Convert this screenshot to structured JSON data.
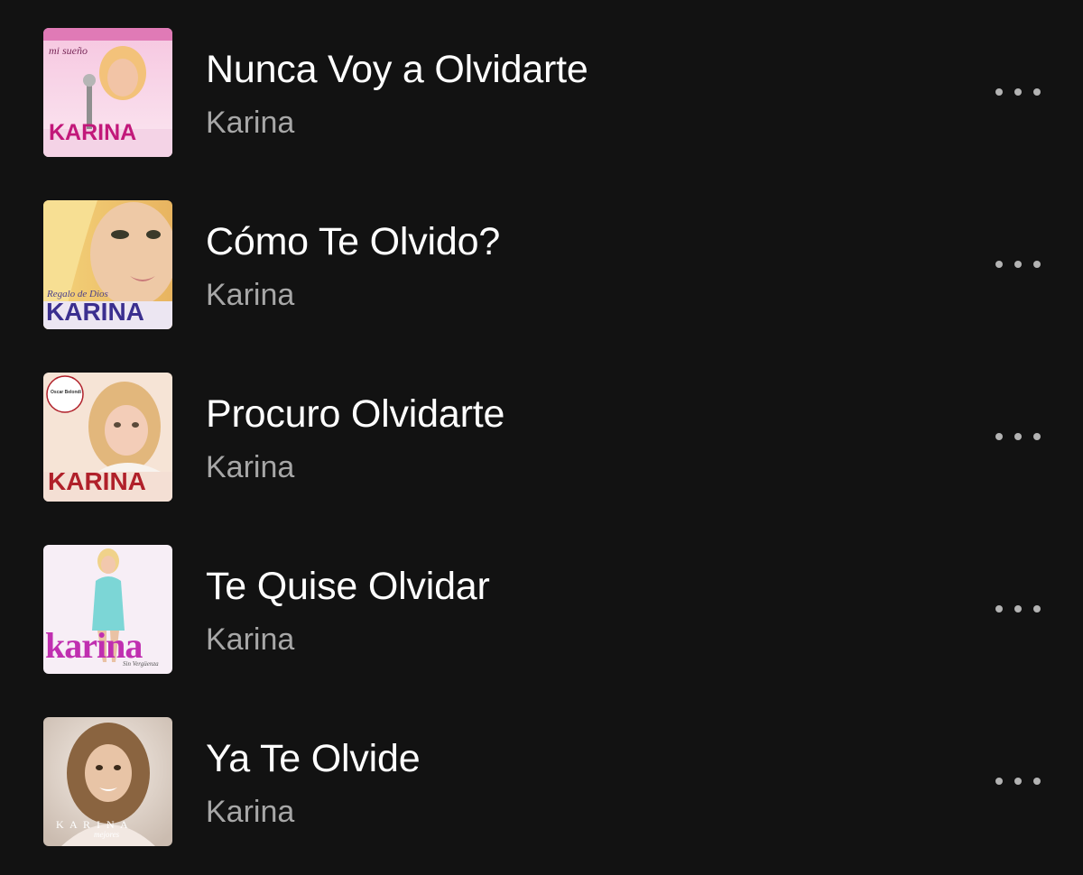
{
  "tracks": [
    {
      "title": "Nunca Voy a Olvidarte",
      "artist": "Karina",
      "cover": {
        "top_text": "mi sueño",
        "name_text": "KARINA",
        "accent": "#d63a9a"
      }
    },
    {
      "title": "Cómo Te Olvido?",
      "artist": "Karina",
      "cover": {
        "top_text": "Regalo de Dios",
        "name_text": "KARINA",
        "accent": "#3b2f8f"
      }
    },
    {
      "title": "Procuro Olvidarte",
      "artist": "Karina",
      "cover": {
        "top_text": "Oscar Belondi",
        "name_text": "KARINA",
        "accent": "#b0202a"
      }
    },
    {
      "title": "Te Quise Olvidar",
      "artist": "Karina",
      "cover": {
        "top_text": "Sin Vergüenza",
        "name_text": "karina",
        "accent": "#c02fb0"
      }
    },
    {
      "title": "Ya Te Olvide",
      "artist": "Karina",
      "cover": {
        "top_text": "mejores",
        "name_text": "K A R I N A",
        "accent": "#f0e6da"
      }
    }
  ],
  "icons": {
    "more": "more-horizontal-icon"
  },
  "colors": {
    "background": "#121212",
    "title": "#ffffff",
    "artist": "#a7a7a7",
    "dots": "#b3b3b3"
  }
}
